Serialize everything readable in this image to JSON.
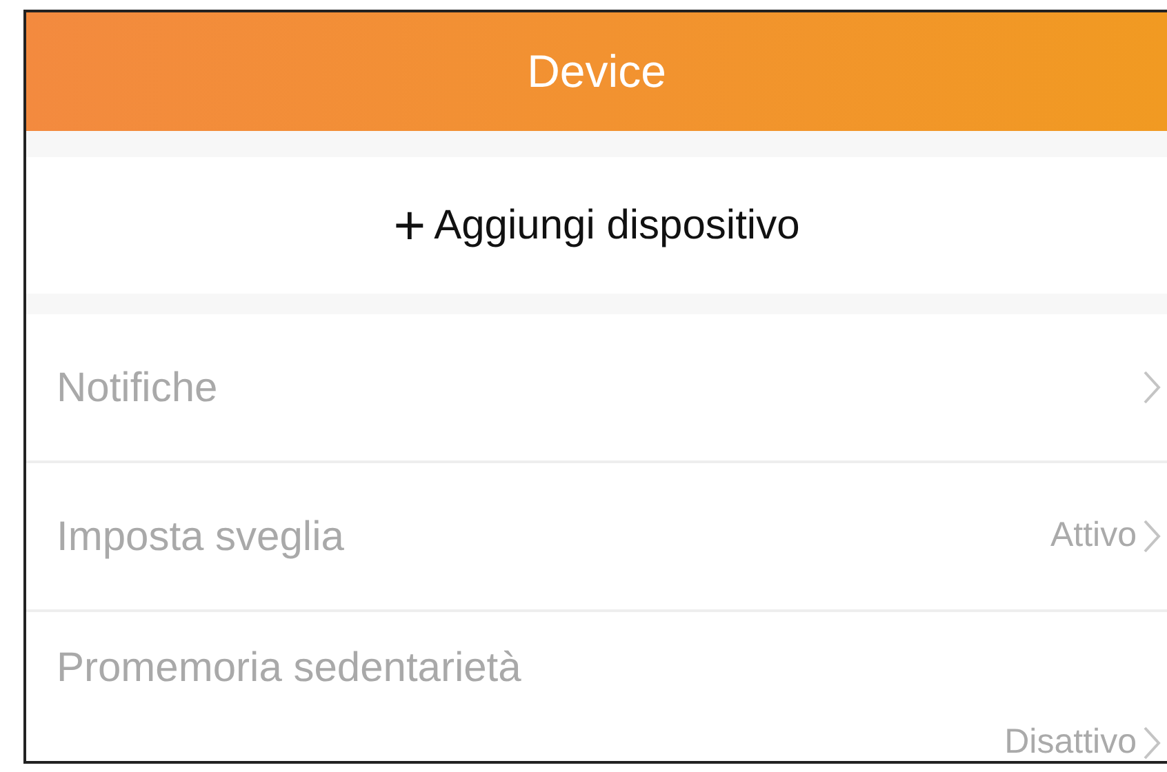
{
  "header": {
    "title": "Device"
  },
  "add_device": {
    "icon": "+",
    "label": "Aggiungi dispositivo"
  },
  "settings": [
    {
      "label": "Notifiche"
    },
    {
      "label": "Imposta sveglia",
      "value": "Attivo"
    },
    {
      "label": "Promemoria sedentarietà",
      "value": "Disattivo"
    }
  ]
}
